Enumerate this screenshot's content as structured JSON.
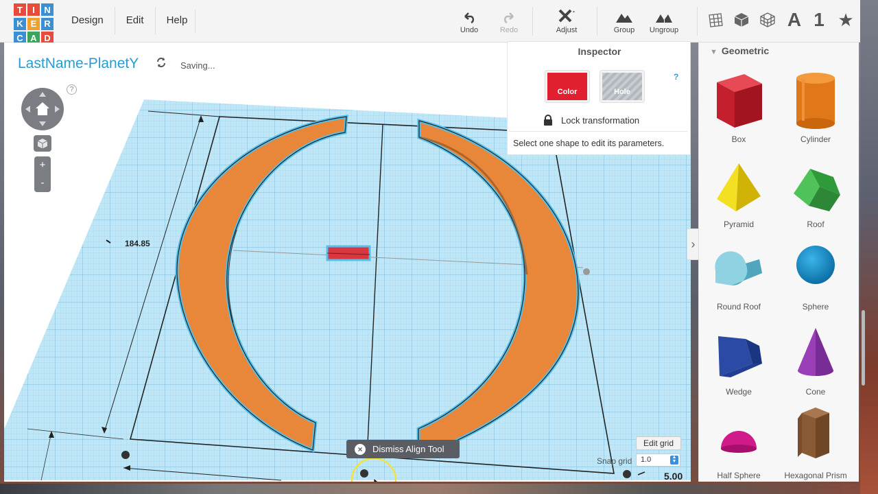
{
  "brand": {
    "logo_letters": [
      "T",
      "I",
      "N",
      "K",
      "E",
      "R",
      "C",
      "A",
      "D"
    ],
    "logo_colors": [
      "#e64b3c",
      "#e64b3c",
      "#3b8fd4",
      "#3b8fd4",
      "#f0a02c",
      "#3b8fd4",
      "#3b8fd4",
      "#3ba55c",
      "#e64b3c"
    ]
  },
  "menu": [
    "Design",
    "Edit",
    "Help"
  ],
  "toolbar": {
    "undo": "Undo",
    "redo": "Redo",
    "adjust": "Adjust",
    "group": "Group",
    "ungroup": "Ungroup"
  },
  "view_icons": [
    "grid-icon",
    "solid-cube-icon",
    "wire-cube-icon",
    "letter-a-icon",
    "number-1-icon",
    "star-icon"
  ],
  "view_text": {
    "letter": "A",
    "number": "1",
    "star": "★"
  },
  "design": {
    "title": "LastName-PlanetY",
    "status": "Saving..."
  },
  "nav": {
    "help": "?",
    "zoom_in": "+",
    "zoom_out": "-"
  },
  "inspector": {
    "title": "Inspector",
    "color_label": "Color",
    "hole_label": "Hole",
    "help": "?",
    "lock_label": "Lock transformation",
    "message": "Select one shape to edit its parameters.",
    "color_hex": "#e0202e"
  },
  "panel": {
    "section": "Geometric",
    "shapes": [
      "Box",
      "Cylinder",
      "Pyramid",
      "Roof",
      "Round Roof",
      "Sphere",
      "Wedge",
      "Cone",
      "Half Sphere",
      "Hexagonal Prism"
    ]
  },
  "workplane": {
    "dimension_left": "184.85",
    "dimension_bottom": "5.00",
    "dismiss_label": "Dismiss Align Tool",
    "dismiss_x": "×",
    "edit_grid": "Edit grid",
    "snap_label": "Snap grid",
    "snap_value": "1.0"
  },
  "colors": {
    "accent": "#2a9bd1",
    "grid": "#a9dcf2",
    "shape_orange": "#e8873a",
    "shape_red": "#d9363e"
  }
}
